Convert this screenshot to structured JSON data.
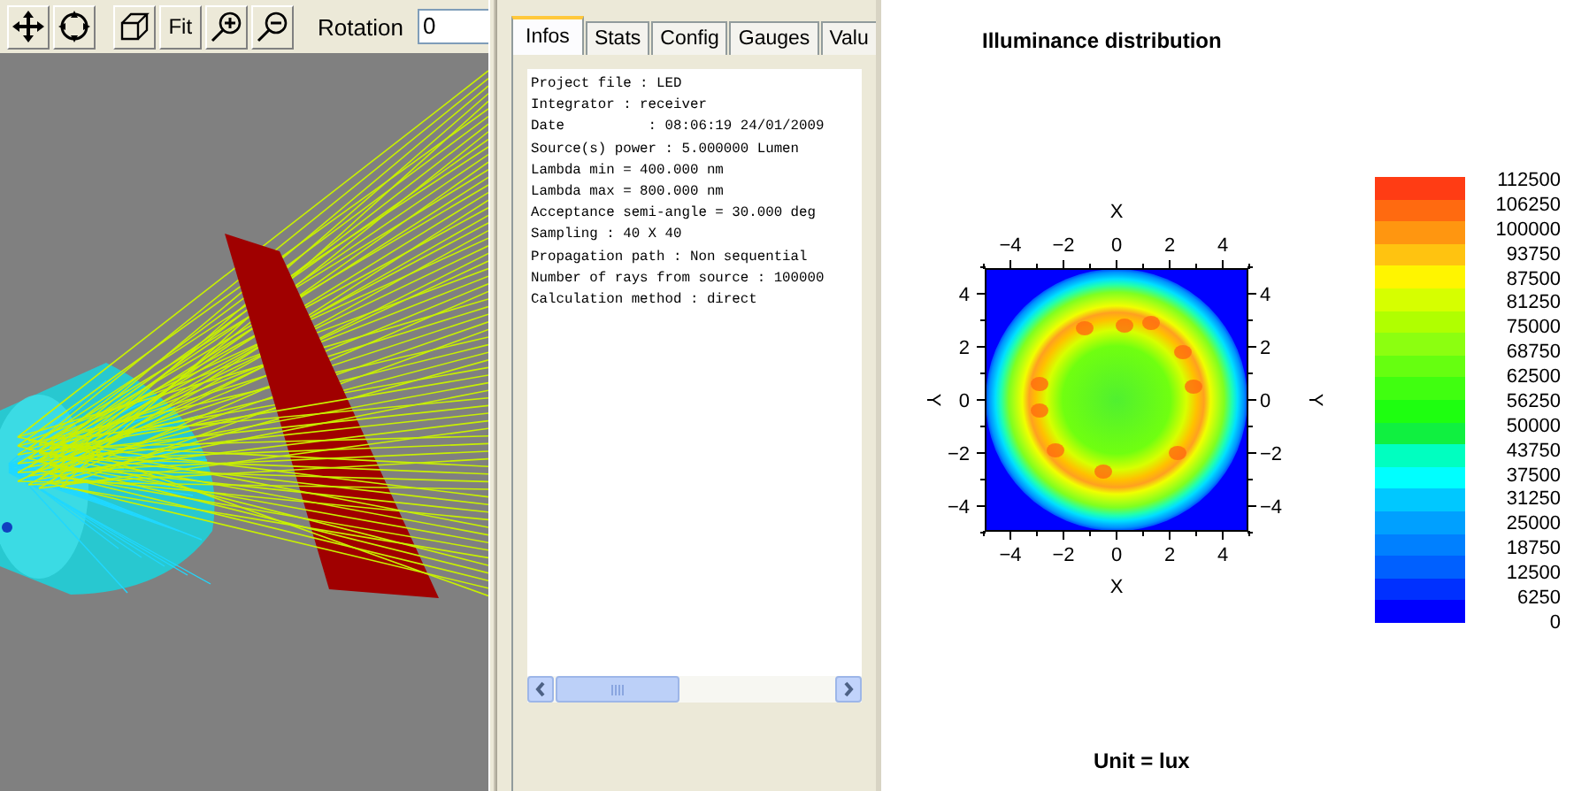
{
  "toolbar": {
    "buttons": [
      {
        "kind": "move"
      },
      {
        "kind": "target"
      },
      {
        "kind": "cube"
      },
      {
        "kind": "text",
        "label": "Fit"
      },
      {
        "kind": "zoom_in"
      },
      {
        "kind": "zoom_out"
      }
    ],
    "rotation": {
      "label": "Rotation",
      "value": "0"
    }
  },
  "tabs": [
    {
      "label": "Infos",
      "selected": true
    },
    {
      "label": "Stats",
      "selected": false
    },
    {
      "label": "Config",
      "selected": false
    },
    {
      "label": "Gauges",
      "selected": false
    },
    {
      "label": "Valu",
      "selected": false
    }
  ],
  "info_lines": [
    "Project file : LED",
    "Integrator : receiver",
    "Date          : 08:06:19 24/01/2009",
    "Source(s) power : 5.000000 Lumen",
    "Lambda min = 400.000 nm",
    "Lambda max = 800.000 nm",
    "Acceptance semi-angle = 30.000 deg",
    "Sampling : 40 X 40",
    "Propagation path : Non sequential",
    "Number of rays from source : 100000",
    "Calculation method : direct"
  ],
  "plot": {
    "title": "Illuminance distribution",
    "axes": {
      "top": {
        "title": "X",
        "ticks": [
          "−4",
          "−2",
          "0",
          "2",
          "4"
        ]
      },
      "bottom": {
        "title": "X",
        "ticks": [
          "−4",
          "−2",
          "0",
          "2",
          "4"
        ]
      },
      "left": {
        "title": "Y",
        "ticks": [
          "4",
          "2",
          "0",
          "−2",
          "−4"
        ]
      },
      "right": {
        "title": "Y",
        "ticks": [
          "4",
          "2",
          "0",
          "−2",
          "−4"
        ]
      }
    },
    "unit": "Unit = lux"
  },
  "colorbar": {
    "segments": [
      {
        "color": "#ff3c14"
      },
      {
        "color": "#ff6a10"
      },
      {
        "color": "#ff9610"
      },
      {
        "color": "#ffc310"
      },
      {
        "color": "#fff500"
      },
      {
        "color": "#d6ff00"
      },
      {
        "color": "#b0ff00"
      },
      {
        "color": "#8cff10"
      },
      {
        "color": "#66ff10"
      },
      {
        "color": "#40ff10"
      },
      {
        "color": "#1eff10"
      },
      {
        "color": "#10f040"
      },
      {
        "color": "#00ffc0"
      },
      {
        "color": "#00ffff"
      },
      {
        "color": "#00c8ff"
      },
      {
        "color": "#00a0ff"
      },
      {
        "color": "#0080ff"
      },
      {
        "color": "#0060ff"
      },
      {
        "color": "#0030ff"
      },
      {
        "color": "#0000ff"
      }
    ],
    "labels": [
      "112500",
      "106250",
      "100000",
      "93750",
      "87500",
      "81250",
      "75000",
      "68750",
      "62500",
      "56250",
      "50000",
      "43750",
      "37500",
      "31250",
      "25000",
      "18750",
      "12500",
      "6250",
      "0"
    ]
  }
}
